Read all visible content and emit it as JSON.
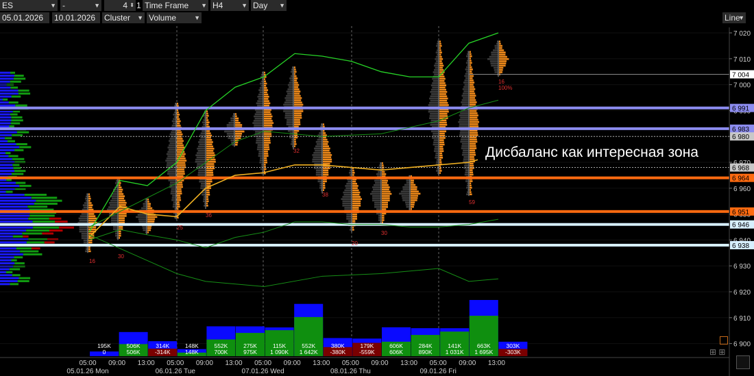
{
  "toolbar": {
    "symbol": "ES",
    "separator": "-",
    "period_count": "4",
    "period_index": "1",
    "timeframe_label": "Time Frame",
    "timeframe_value": "H4",
    "profile_period": "Day",
    "date_from": "05.01.2026",
    "date_to": "10.01.2026",
    "chart_type": "Cluster",
    "cluster_mode": "Volume",
    "line_button": "Line"
  },
  "annotation": "Дисбаланс как интересная зона",
  "colors": {
    "background": "#000000",
    "level_blue": "#8c8cf0",
    "level_orange": "#ff6a10",
    "level_white": "#d7f0ff",
    "bar_blue": "#0a0aff",
    "bar_green": "#0f8f0f",
    "bar_red": "#7a0000",
    "line_green": "#27c427",
    "line_yellow": "#f0b021"
  },
  "chart_data": {
    "type": "bar",
    "price_axis": {
      "min": 6893,
      "max": 7025,
      "ticks": [
        "7 020",
        "7 010",
        "7 000",
        "6 990",
        "6 980",
        "6 970",
        "6 960",
        "6 950",
        "6 940",
        "6 930",
        "6 920",
        "6 910",
        "6 900"
      ]
    },
    "price_tags": [
      {
        "label": "7 004",
        "price": 7004,
        "style": "white-box"
      },
      {
        "label": "6 991",
        "price": 6991,
        "style": "blue"
      },
      {
        "label": "6 983",
        "price": 6983,
        "style": "blue"
      },
      {
        "label": "6 980",
        "price": 6980,
        "style": "grey"
      },
      {
        "label": "6 968",
        "price": 6968,
        "style": "grey"
      },
      {
        "label": "6 964",
        "price": 6964,
        "style": "orange"
      },
      {
        "label": "6 951",
        "price": 6951,
        "style": "orange"
      },
      {
        "label": "6 946",
        "price": 6946,
        "style": "white"
      },
      {
        "label": "6 938",
        "price": 6938,
        "style": "white"
      }
    ],
    "time_ticks": [
      "05:00",
      "09:00",
      "13:00",
      "05:00",
      "09:00",
      "13:00",
      "05:00",
      "09:00",
      "13:00",
      "05:00",
      "09:00",
      "13:00",
      "05:00",
      "09:00",
      "13:00"
    ],
    "day_labels": [
      "05.01.26 Mon",
      "06.01.26 Tue",
      "07.01.26 Wed",
      "08.01.26 Thu",
      "09.01.26 Fri"
    ],
    "volume_bars": [
      {
        "total": 195,
        "delta": 0,
        "label1": "195K",
        "label2": "0"
      },
      {
        "total": 1012,
        "delta": 506,
        "label1": "506K",
        "label2": "506K"
      },
      {
        "total": 628,
        "delta": -314,
        "label1": "314K",
        "label2": "-314K"
      },
      {
        "total": 296,
        "delta": 148,
        "label1": "148K",
        "label2": "148K"
      },
      {
        "total": 1252,
        "delta": 700,
        "label1": "552K",
        "label2": "700K"
      },
      {
        "total": 1250,
        "delta": 975,
        "label1": "275K",
        "label2": "975K"
      },
      {
        "total": 1205,
        "delta": 1090,
        "label1": "115K",
        "label2": "1 090K"
      },
      {
        "total": 2194,
        "delta": 1642,
        "label1": "552K",
        "label2": "1 642K"
      },
      {
        "total": 760,
        "delta": -380,
        "label1": "380K",
        "label2": "-380K"
      },
      {
        "total": 738,
        "delta": -559,
        "label1": "179K",
        "label2": "-559K"
      },
      {
        "total": 1212,
        "delta": 606,
        "label1": "606K",
        "label2": "606K"
      },
      {
        "total": 1174,
        "delta": 890,
        "label1": "284K",
        "label2": "890K"
      },
      {
        "total": 1172,
        "delta": 1031,
        "label1": "141K",
        "label2": "1 031K"
      },
      {
        "total": 2358,
        "delta": 1695,
        "label1": "663K",
        "label2": "1 695K"
      },
      {
        "total": 606,
        "delta": -303,
        "label1": "303K",
        "label2": "-303K"
      }
    ],
    "profile_counts": [
      "16",
      "30",
      "25",
      "36",
      "32",
      "38",
      "20",
      "30",
      "59",
      "16",
      "100%"
    ]
  }
}
